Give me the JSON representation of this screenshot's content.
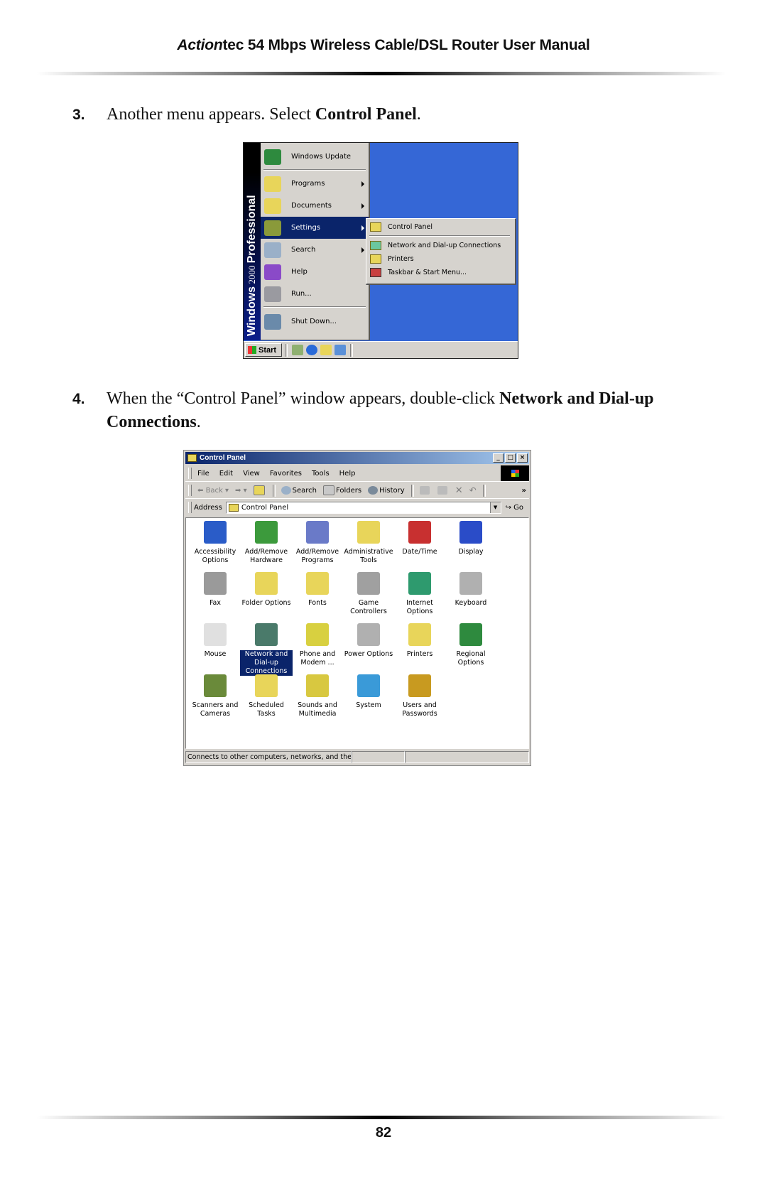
{
  "header": {
    "brand_italic": "Action",
    "brand_rest": "tec 54 Mbps Wireless Cable/DSL Router User Manual"
  },
  "steps": [
    {
      "number": "3.",
      "text_before": "Another menu appears. Select ",
      "bold": "Control Panel",
      "text_after": "."
    },
    {
      "number": "4.",
      "text_before": "When the “Control Panel” window appears, double-click ",
      "bold": "Network and Dial-up Connections",
      "text_after": "."
    }
  ],
  "start_menu": {
    "banner_bold": "Windows",
    "banner_mid": " 2000 ",
    "banner_end": "Professional",
    "items": [
      {
        "label": "Windows Update",
        "icon": "windows-update-icon",
        "submenu": false
      },
      {
        "label": "Programs",
        "icon": "programs-icon",
        "submenu": true
      },
      {
        "label": "Documents",
        "icon": "documents-icon",
        "submenu": true
      },
      {
        "label": "Settings",
        "icon": "settings-icon",
        "submenu": true,
        "selected": true
      },
      {
        "label": "Search",
        "icon": "search-icon",
        "submenu": true
      },
      {
        "label": "Help",
        "icon": "help-icon",
        "submenu": false
      },
      {
        "label": "Run...",
        "icon": "run-icon",
        "submenu": false
      },
      {
        "label": "Shut Down...",
        "icon": "shutdown-icon",
        "submenu": false
      }
    ],
    "settings_submenu": [
      {
        "label": "Control Panel",
        "icon": "control-panel-icon"
      },
      {
        "label": "Network and Dial-up Connections",
        "icon": "network-icon"
      },
      {
        "label": "Printers",
        "icon": "printers-icon"
      },
      {
        "label": "Taskbar & Start Menu...",
        "icon": "taskbar-icon"
      }
    ],
    "start_label": "Start"
  },
  "control_panel": {
    "title": "Control Panel",
    "menu": [
      "File",
      "Edit",
      "View",
      "Favorites",
      "Tools",
      "Help"
    ],
    "menu_underline": [
      "F",
      "E",
      "V",
      "a",
      "T",
      "H"
    ],
    "toolbar": {
      "back": "Back",
      "search": "Search",
      "folders": "Folders",
      "history": "History",
      "more": "»"
    },
    "address_label": "Address",
    "address_value": "Control Panel",
    "go_label": "Go",
    "items": [
      {
        "label": "Accessibility Options",
        "icon": "accessibility-icon",
        "color": "#2a5cc8"
      },
      {
        "label": "Add/Remove Hardware",
        "icon": "add-remove-hardware-icon",
        "color": "#3c9a3c"
      },
      {
        "label": "Add/Remove Programs",
        "icon": "add-remove-programs-icon",
        "color": "#6a7ac8"
      },
      {
        "label": "Administrative Tools",
        "icon": "administrative-tools-icon",
        "color": "#e8d55a"
      },
      {
        "label": "Date/Time",
        "icon": "date-time-icon",
        "color": "#c83030"
      },
      {
        "label": "Display",
        "icon": "display-icon",
        "color": "#2a4cc8"
      },
      {
        "label": "Fax",
        "icon": "fax-icon",
        "color": "#9a9a9a"
      },
      {
        "label": "Folder Options",
        "icon": "folder-options-icon",
        "color": "#e8d55a"
      },
      {
        "label": "Fonts",
        "icon": "fonts-icon",
        "color": "#e8d55a"
      },
      {
        "label": "Game Controllers",
        "icon": "game-controllers-icon",
        "color": "#a0a0a0"
      },
      {
        "label": "Internet Options",
        "icon": "internet-options-icon",
        "color": "#2e9a6e"
      },
      {
        "label": "Keyboard",
        "icon": "keyboard-icon",
        "color": "#b0b0b0"
      },
      {
        "label": "Mouse",
        "icon": "mouse-icon",
        "color": "#e0e0e0"
      },
      {
        "label": "Network and Dial-up Connections",
        "icon": "network-dialup-icon",
        "color": "#4a7a6a",
        "selected": true
      },
      {
        "label": "Phone and Modem ...",
        "icon": "phone-modem-icon",
        "color": "#d8d040"
      },
      {
        "label": "Power Options",
        "icon": "power-options-icon",
        "color": "#b0b0b0"
      },
      {
        "label": "Printers",
        "icon": "printers-folder-icon",
        "color": "#e8d55a"
      },
      {
        "label": "Regional Options",
        "icon": "regional-options-icon",
        "color": "#2e8a3e"
      },
      {
        "label": "Scanners and Cameras",
        "icon": "scanners-cameras-icon",
        "color": "#6a8a3a"
      },
      {
        "label": "Scheduled Tasks",
        "icon": "scheduled-tasks-icon",
        "color": "#e8d55a"
      },
      {
        "label": "Sounds and Multimedia",
        "icon": "sounds-multimedia-icon",
        "color": "#d8c840"
      },
      {
        "label": "System",
        "icon": "system-icon",
        "color": "#3a9ad8"
      },
      {
        "label": "Users and Passwords",
        "icon": "users-passwords-icon",
        "color": "#c89a20"
      }
    ],
    "status_text": "Connects to other computers, networks, and the I"
  },
  "footer": {
    "page_number": "82"
  },
  "colors": {
    "desktop": "#3567d6",
    "selection": "#0a246a",
    "window_face": "#d6d3ce"
  }
}
